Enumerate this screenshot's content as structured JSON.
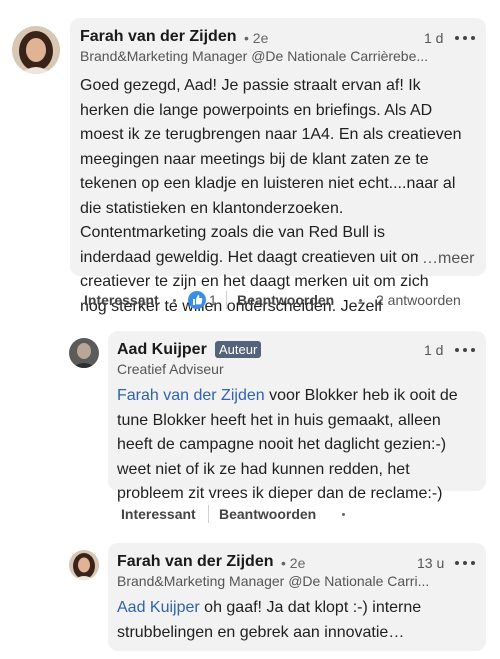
{
  "comments": [
    {
      "name": "Farah van der Zijden",
      "degree": "• 2e",
      "subtitle": "Brand&Marketing Manager @De Nationale Carrièrebe...",
      "time": "1 d",
      "text_lines": [
        "Goed gezegd, Aad! Je passie straalt ervan af! Ik",
        "herken die lange powerpoints en briefings. Als AD",
        "moest ik ze terugbrengen naar 1A4. En als creatieven",
        "meegingen naar meetings bij de klant zaten ze te",
        "tekenen op een kladje en luisteren niet echt....naar al",
        "die statistieken en klantonderzoeken.",
        "Contentmarketing zoals die van Red Bull is",
        "inderdaad geweldig. Het daagt creatieven uit om nóg",
        "creatiever te zijn en het daagt merken uit om zich",
        "nog sterker te willen onderscheiden. Jezelf"
      ],
      "see_more": "…meer",
      "actions": {
        "like": "Interessant",
        "reaction_count": "1",
        "reply": "Beantwoorden",
        "replies": "2 antwoorden"
      }
    },
    {
      "name": "Aad Kuijper",
      "badge": "Auteur",
      "subtitle": "Creatief Adviseur",
      "time": "1 d",
      "mention": "Farah van der Zijden",
      "text_first_rest": " voor Blokker heb ik ooit de",
      "text_lines": [
        "tune Blokker heeft het in huis gemaakt, alleen",
        "heeft de campagne nooit het daglicht gezien:-)",
        "weet niet of ik ze had kunnen redden, het",
        "probleem zit vrees ik dieper dan de reclame:-)"
      ],
      "actions": {
        "like": "Interessant",
        "reply": "Beantwoorden"
      }
    },
    {
      "name": "Farah van der Zijden",
      "degree": "• 2e",
      "subtitle": "Brand&Marketing Manager @De Nationale Carri...",
      "time": "13 u",
      "mention": "Aad Kuijper",
      "text_first_rest": " oh gaaf! Ja dat klopt :-) interne",
      "text_lines": [
        "strubbelingen en gebrek aan innovatie…"
      ]
    }
  ],
  "colors": {
    "mention": "#2f62b0",
    "badge": "#55637a",
    "bubble": "#f2f2f2",
    "reaction": "#378fe9"
  },
  "icons": [
    "more-icon",
    "thumbs-up-icon"
  ]
}
